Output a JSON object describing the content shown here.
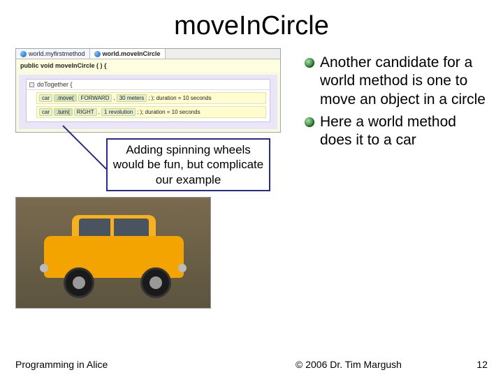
{
  "title": "moveInCircle",
  "editor": {
    "tabs": [
      "world.myfirstmethod",
      "world.moveInCircle"
    ],
    "signature": "public void moveInCircle ( ) {",
    "do_together": "doTogether {",
    "rows": [
      {
        "obj": "car",
        "cmd": ".move(",
        "dir": "FORWARD",
        "amount": "30 meters",
        "extra": "); duration = 10 seconds"
      },
      {
        "obj": "car",
        "cmd": ".turn(",
        "dir": "RIGHT",
        "amount": "1 revolution",
        "extra": "); duration = 10 seconds"
      }
    ]
  },
  "callout": "Adding spinning wheels would be fun, but complicate our example",
  "bullets": [
    "Another candidate for a world method is one to move an object in a circle",
    "Here a world method does it to a car"
  ],
  "footer": {
    "left": "Programming in Alice",
    "center": "© 2006 Dr. Tim Margush",
    "right": "12"
  }
}
